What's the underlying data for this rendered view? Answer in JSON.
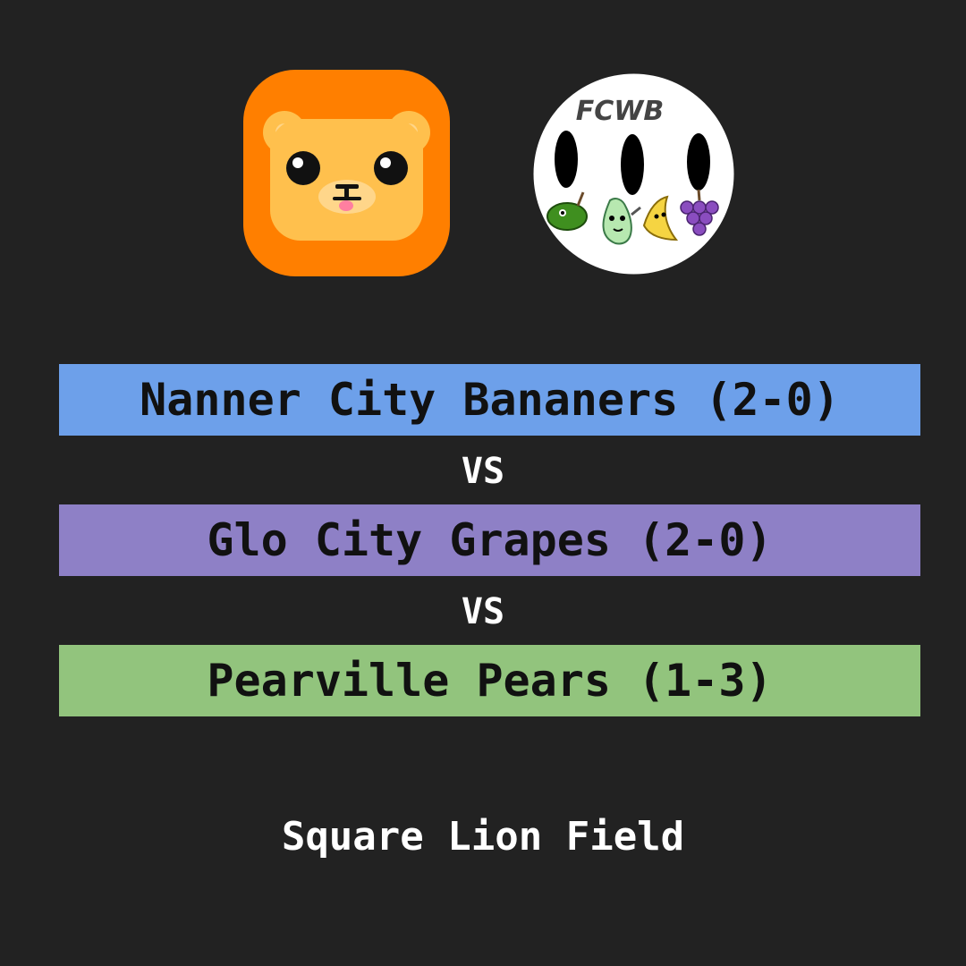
{
  "logos": {
    "home_icon": "lion-face-icon",
    "league_icon": "fcwb-badge-icon",
    "league_badge_text": "FCWB"
  },
  "matchup": {
    "teams": [
      {
        "label": "Nanner City Bananers (2-0)",
        "color": "#6da0ea"
      },
      {
        "label": "Glo City Grapes (2-0)",
        "color": "#8e80c6"
      },
      {
        "label": "Pearville Pears (1-3)",
        "color": "#92c47d"
      }
    ],
    "separator": "VS"
  },
  "venue": "Square Lion Field",
  "colors": {
    "background": "#222222",
    "text_light": "#ffffff",
    "text_dark": "#111111",
    "lion_orange": "#ff7f00",
    "lion_face": "#ffc04d"
  }
}
